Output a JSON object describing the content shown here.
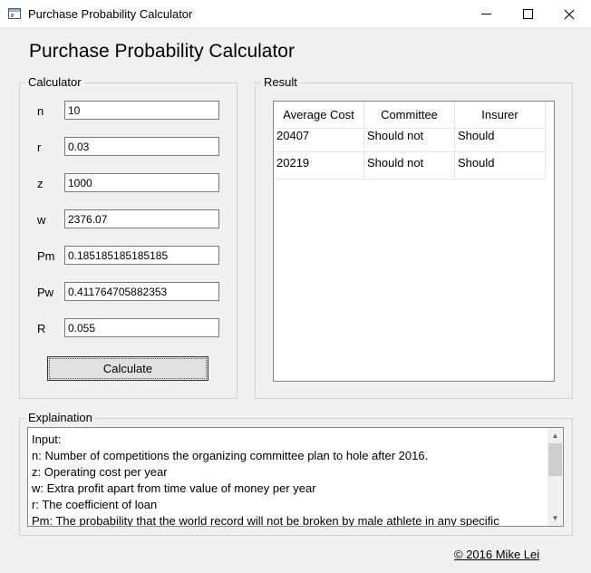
{
  "window": {
    "title": "Purchase Probability Calculator",
    "controls": {
      "minimize": "—",
      "maximize": "□",
      "close": "✕"
    }
  },
  "app_title": "Purchase Probability Calculator",
  "calculator": {
    "label": "Calculator",
    "fields": [
      {
        "label": "n",
        "value": "10"
      },
      {
        "label": "r",
        "value": "0.03"
      },
      {
        "label": "z",
        "value": "1000"
      },
      {
        "label": "w",
        "value": "2376.07"
      },
      {
        "label": "Pm",
        "value": "0.185185185185185"
      },
      {
        "label": "Pw",
        "value": "0.411764705882353"
      },
      {
        "label": "R",
        "value": "0.055"
      }
    ],
    "button_label": "Calculate"
  },
  "result": {
    "label": "Result",
    "columns": [
      "Average Cost",
      "Committee",
      "Insurer"
    ],
    "rows": [
      [
        "20407",
        "Should not",
        "Should"
      ],
      [
        "20219",
        "Should not",
        "Should"
      ]
    ]
  },
  "explanation": {
    "label": "Explaination",
    "lines": [
      "Input:",
      "n: Number of competitions the organizing committee plan to hole after 2016.",
      "z: Operating cost per year",
      "w: Extra profit apart from time value of money per year",
      "r: The coefficient of loan",
      "Pm: The probability that the world record will not be broken by male athlete in any specific"
    ],
    "scroll": {
      "up": "▲",
      "down": "▼"
    }
  },
  "footer": {
    "copyright": "© 2016 Mike Lei"
  }
}
